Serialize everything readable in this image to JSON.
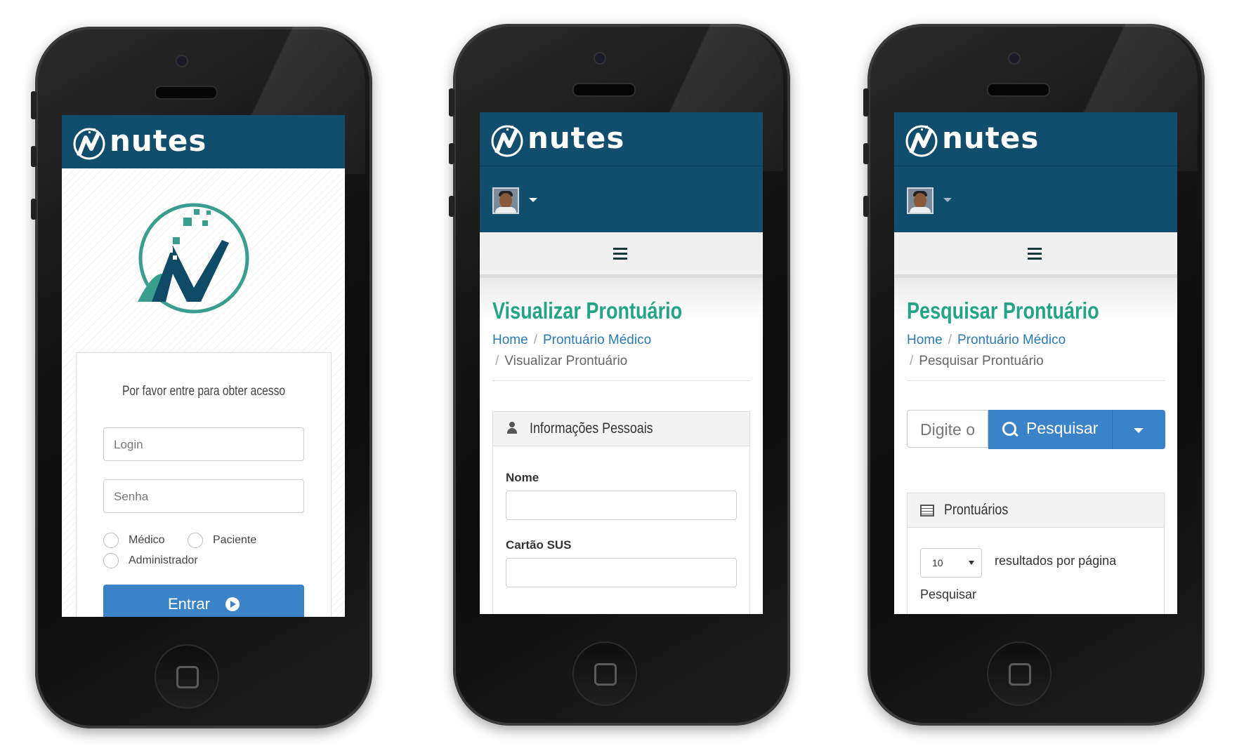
{
  "brand": {
    "name": "nutes"
  },
  "login": {
    "prompt": "Por favor entre para obter acesso",
    "login_placeholder": "Login",
    "password_placeholder": "Senha",
    "roles": [
      "Médico",
      "Paciente",
      "Administrador"
    ],
    "submit_label": "Entrar"
  },
  "view": {
    "title": "Visualizar Prontuário",
    "breadcrumb": [
      "Home",
      "Prontuário Médico",
      "Visualizar Prontuário"
    ],
    "panel_title": "Informações Pessoais",
    "fields": [
      "Nome",
      "Cartão SUS"
    ]
  },
  "search": {
    "title": "Pesquisar Prontuário",
    "breadcrumb": [
      "Home",
      "Prontuário Médico",
      "Pesquisar Prontuário"
    ],
    "input_placeholder": "Digite o",
    "button_label": "Pesquisar",
    "panel_title": "Prontuários",
    "page_size": "10",
    "page_size_label": "resultados por página",
    "filter_label": "Pesquisar"
  },
  "colors": {
    "header": "#114d6c",
    "accent_green": "#23a484",
    "button_blue": "#3b83c9"
  }
}
